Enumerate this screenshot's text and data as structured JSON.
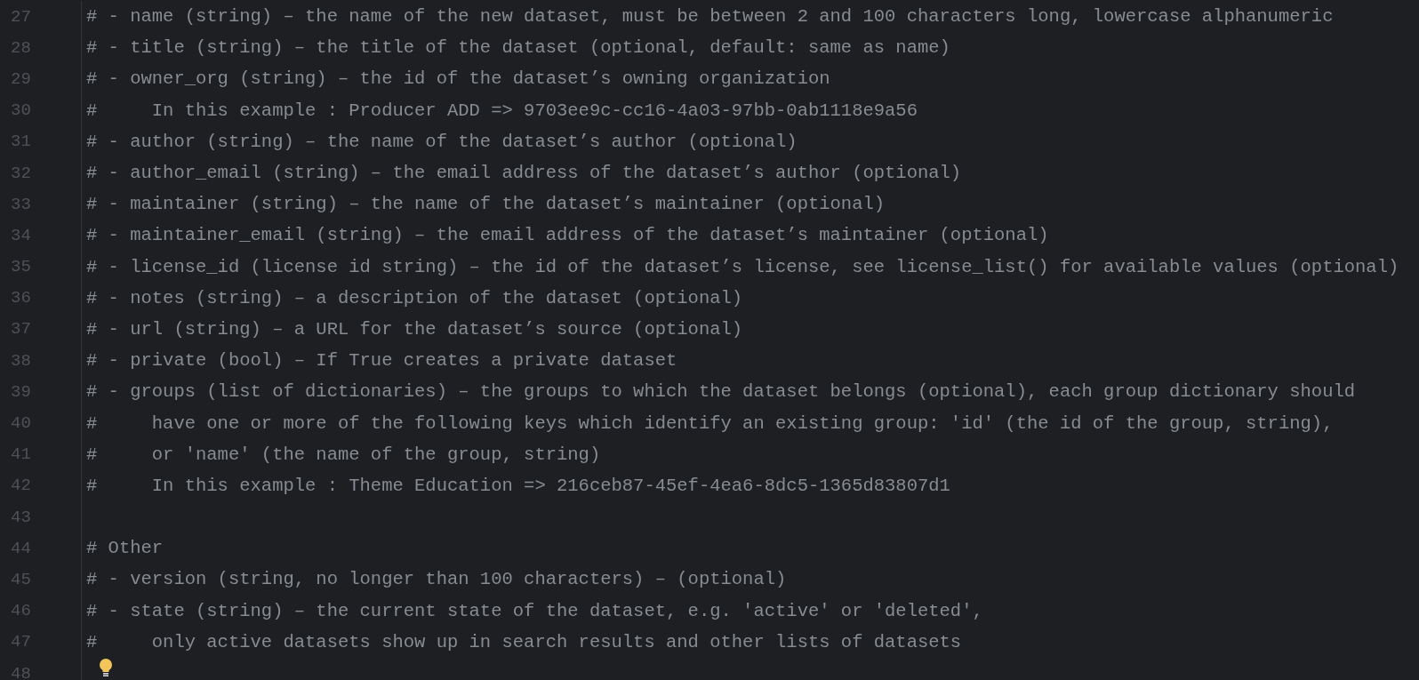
{
  "editor": {
    "lines": [
      {
        "number": "27",
        "kind": "code",
        "text": "# - name (string) – the name of the new dataset, must be between 2 and 100 characters long, lowercase alphanumeric"
      },
      {
        "number": "28",
        "kind": "code",
        "text": "# - title (string) – the title of the dataset (optional, default: same as name)"
      },
      {
        "number": "29",
        "kind": "code",
        "text": "# - owner_org (string) – the id of the dataset’s owning organization"
      },
      {
        "number": "30",
        "kind": "code",
        "text": "#     In this example : Producer ADD => 9703ee9c-cc16-4a03-97bb-0ab1118e9a56"
      },
      {
        "number": "31",
        "kind": "code",
        "text": "# - author (string) – the name of the dataset’s author (optional)"
      },
      {
        "number": "32",
        "kind": "code",
        "text": "# - author_email (string) – the email address of the dataset’s author (optional)"
      },
      {
        "number": "33",
        "kind": "code",
        "text": "# - maintainer (string) – the name of the dataset’s maintainer (optional)"
      },
      {
        "number": "34",
        "kind": "code",
        "text": "# - maintainer_email (string) – the email address of the dataset’s maintainer (optional)"
      },
      {
        "number": "35",
        "kind": "code",
        "text": "# - license_id (license id string) – the id of the dataset’s license, see license_list() for available values (optional)"
      },
      {
        "number": "36",
        "kind": "code",
        "text": "# - notes (string) – a description of the dataset (optional)"
      },
      {
        "number": "37",
        "kind": "code",
        "text": "# - url (string) – a URL for the dataset’s source (optional)"
      },
      {
        "number": "38",
        "kind": "code",
        "text": "# - private (bool) – If True creates a private dataset"
      },
      {
        "number": "39",
        "kind": "code",
        "text": "# - groups (list of dictionaries) – the groups to which the dataset belongs (optional), each group dictionary should"
      },
      {
        "number": "40",
        "kind": "code",
        "text": "#     have one or more of the following keys which identify an existing group: 'id' (the id of the group, string),"
      },
      {
        "number": "41",
        "kind": "code",
        "text": "#     or 'name' (the name of the group, string)"
      },
      {
        "number": "42",
        "kind": "code",
        "text": "#     In this example : Theme Education => 216ceb87-45ef-4ea6-8dc5-1365d83807d1"
      },
      {
        "number": "43",
        "kind": "code"
      },
      {
        "number": "44",
        "kind": "code",
        "text": "# Other"
      },
      {
        "number": "45",
        "kind": "code",
        "text": "# - version (string, no longer than 100 characters) – (optional)"
      },
      {
        "number": "46",
        "kind": "code",
        "text": "# - state (string) – the current state of the dataset, e.g. 'active' or 'deleted',"
      },
      {
        "number": "47",
        "kind": "code",
        "text": "#     only active datasets show up in search results and other lists of datasets"
      },
      {
        "number": "48",
        "kind": "bulb"
      }
    ]
  }
}
